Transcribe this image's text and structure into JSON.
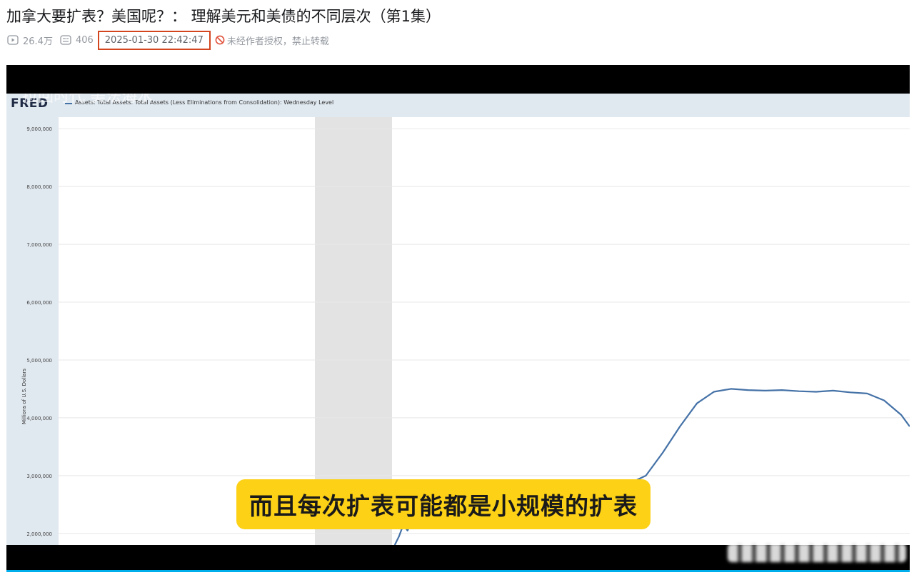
{
  "title": "加拿大要扩表？美国呢？：  理解美元和美债的不同层次（第1集）",
  "meta": {
    "views": "26.4万",
    "danmaku": "406",
    "datetime": "2025-01-30 22:42:47",
    "notice": "未经作者授权，禁止转载"
  },
  "video": {
    "watermark": "拉回时代   美法海水",
    "fred_logo": "FRED",
    "legend": "Assets: Total Assets: Total Assets (Less Eliminations from Consolidation): Wednesday Level",
    "ylabel": "Millions of U.S. Dollars",
    "subtitle": "而且每次扩表可能都是小规模的扩表",
    "accent": "#fcd116",
    "progress_color": "#00aeec"
  },
  "chart_data": {
    "type": "line",
    "title": "",
    "ylabel": "Millions of U.S. Dollars",
    "ylim": [
      1800000,
      9200000
    ],
    "yticks": [
      "9,000,000",
      "8,000,000",
      "7,000,000",
      "6,000,000",
      "5,000,000",
      "4,000,000",
      "3,000,000",
      "2,000,000"
    ],
    "ytick_values": [
      9000000,
      8000000,
      7000000,
      6000000,
      5000000,
      4000000,
      3000000,
      2000000
    ],
    "recession_shading": true,
    "series": [
      {
        "name": "",
        "color": "#4572a7",
        "x": [
          0.395,
          0.4,
          0.405,
          0.41,
          0.415,
          0.42,
          0.425,
          0.43,
          0.435,
          0.44,
          0.45,
          0.47,
          0.49,
          0.51,
          0.53,
          0.55,
          0.57,
          0.59,
          0.61,
          0.63,
          0.65,
          0.67,
          0.69,
          0.71,
          0.73,
          0.75,
          0.77,
          0.79,
          0.81,
          0.83,
          0.85,
          0.87,
          0.89,
          0.91,
          0.93,
          0.95,
          0.97,
          0.99,
          1.0
        ],
        "values": [
          1800000,
          1950000,
          2150000,
          2050000,
          2200000,
          2100000,
          2250000,
          2350000,
          2400000,
          2500000,
          2600000,
          2700000,
          2750000,
          2780000,
          2800000,
          2820000,
          2850000,
          2870000,
          2900000,
          2850000,
          2880000,
          2860000,
          3000000,
          3400000,
          3850000,
          4250000,
          4450000,
          4500000,
          4480000,
          4470000,
          4480000,
          4460000,
          4450000,
          4470000,
          4440000,
          4420000,
          4300000,
          4050000,
          3850000
        ]
      }
    ]
  }
}
